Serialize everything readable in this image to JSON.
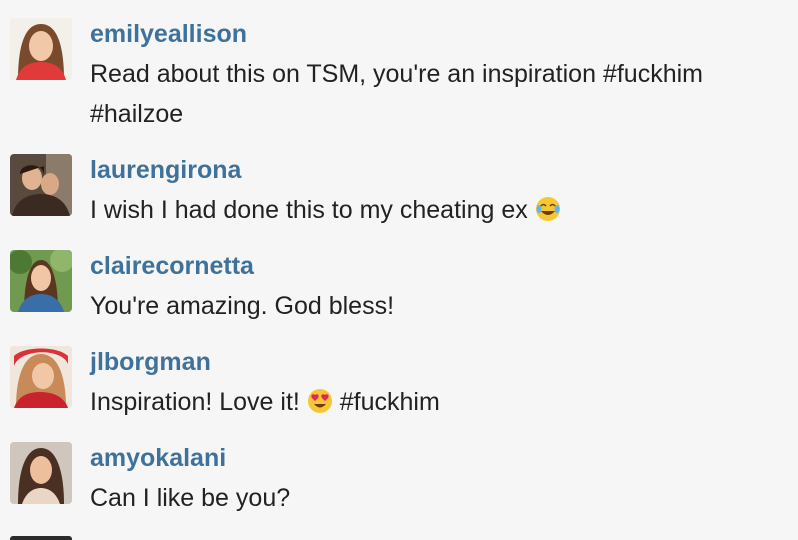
{
  "comments": [
    {
      "username": "emilyeallison",
      "text_before": "Read about this on TSM, you're an inspiration #fuckhim #hailzoe",
      "emoji": "",
      "text_after": ""
    },
    {
      "username": "laurengirona",
      "text_before": "I wish I had done this to my cheating ex ",
      "emoji": "face-with-tears-of-joy-emoji",
      "text_after": ""
    },
    {
      "username": "clairecornetta",
      "text_before": "You're amazing. God bless!",
      "emoji": "",
      "text_after": ""
    },
    {
      "username": "jlborgman",
      "text_before": "Inspiration! Love it! ",
      "emoji": "heart-eyes-emoji",
      "text_after": " #fuckhim"
    },
    {
      "username": "amyokalani",
      "text_before": "Can I like be you?",
      "emoji": "",
      "text_after": ""
    }
  ],
  "colors": {
    "background": "#f6f6f6",
    "username": "#3f729b",
    "text": "#222222"
  }
}
